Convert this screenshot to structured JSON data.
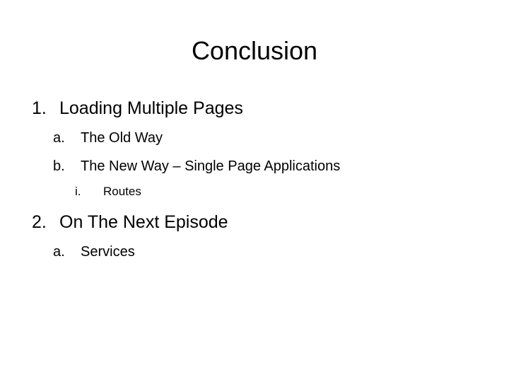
{
  "slide": {
    "title": "Conclusion",
    "items": [
      {
        "marker": "1.",
        "label": "Loading Multiple Pages",
        "subitems": [
          {
            "marker": "a.",
            "label": "The Old Way"
          },
          {
            "marker": "b.",
            "label": "The New Way – Single Page Applications",
            "subitems": [
              {
                "marker": "i.",
                "label": "Routes"
              }
            ]
          }
        ]
      },
      {
        "marker": "2.",
        "label": "On The Next Episode",
        "subitems": [
          {
            "marker": "a.",
            "label": "Services"
          }
        ]
      }
    ]
  }
}
